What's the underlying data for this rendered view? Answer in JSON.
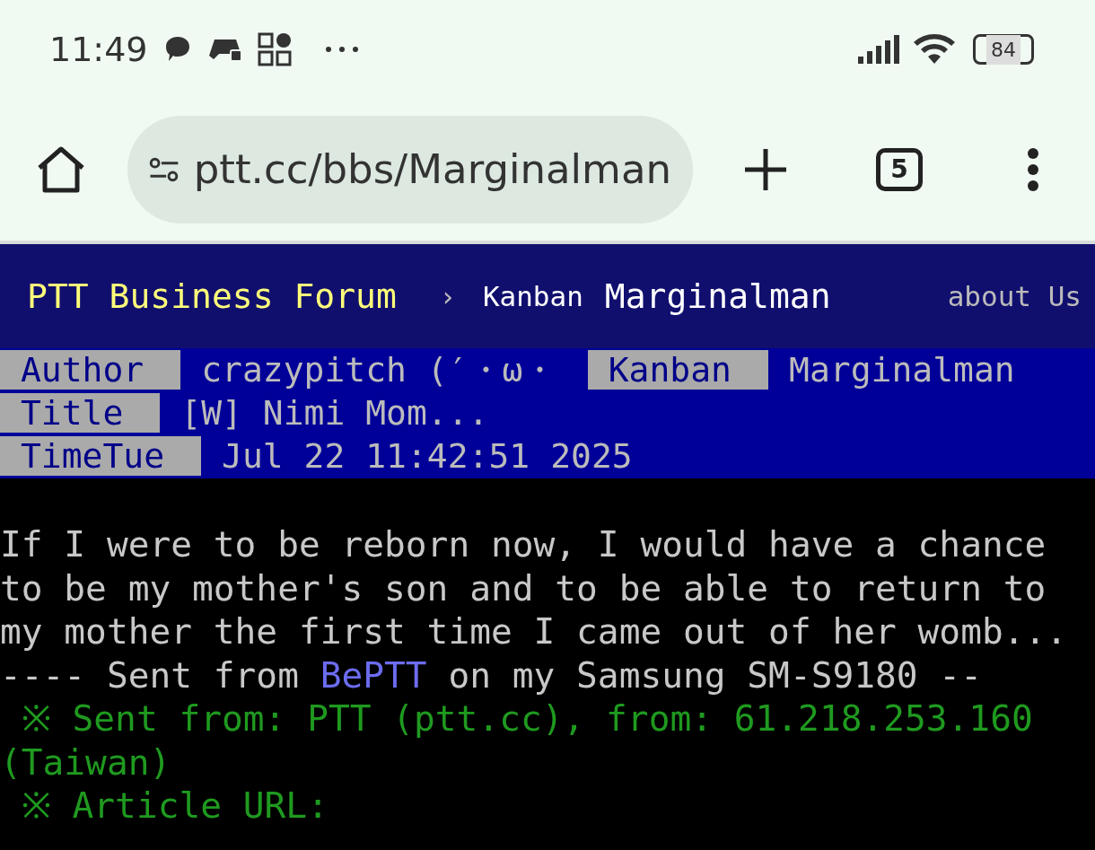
{
  "status_bar": {
    "time": "11:49",
    "battery": "84"
  },
  "browser": {
    "url": "ptt.cc/bbs/Marginalman",
    "tab_count": "5"
  },
  "board_nav": {
    "site_title": "PTT Business Forum",
    "separator": "›",
    "board_label": "Kanban",
    "board_name": "Marginalman",
    "about": "about Us"
  },
  "article_header": {
    "rows": [
      {
        "cells": [
          {
            "kind": "label",
            "text": "Author"
          },
          {
            "kind": "value",
            "text": "crazypitch (′・ω・"
          },
          {
            "kind": "label",
            "text": "Kanban"
          },
          {
            "kind": "value",
            "text": "Marginalman"
          }
        ]
      },
      {
        "cells": [
          {
            "kind": "label",
            "text": "Title"
          },
          {
            "kind": "value",
            "text": "[W] Nimi Mom..."
          }
        ]
      },
      {
        "cells": [
          {
            "kind": "label",
            "text": "TimeTue"
          },
          {
            "kind": "value",
            "text": "Jul 22 11:42:51 2025"
          }
        ]
      }
    ]
  },
  "body": {
    "lines": [
      {
        "segments": [
          {
            "kind": "plain",
            "text": "If I were to be reborn now, I would have a chance"
          }
        ]
      },
      {
        "segments": [
          {
            "kind": "plain",
            "text": "to be my mother's son and to be able to return to"
          }
        ]
      },
      {
        "segments": [
          {
            "kind": "plain",
            "text": "my mother the first time I came out of her womb..."
          }
        ]
      },
      {
        "segments": [
          {
            "kind": "plain",
            "text": "---- Sent from"
          },
          {
            "kind": "link",
            "text": "BePTT"
          },
          {
            "kind": "plain",
            "text": "on my Samsung SM-S9180 --"
          }
        ]
      },
      {
        "segments": [
          {
            "kind": "green",
            "text": " ※ Sent from: PTT (ptt.cc), from: 61.218.253.160"
          }
        ]
      },
      {
        "segments": [
          {
            "kind": "green",
            "text": "(Taiwan)"
          }
        ]
      },
      {
        "segments": [
          {
            "kind": "green",
            "text": " ※ Article URL:"
          }
        ]
      }
    ]
  }
}
